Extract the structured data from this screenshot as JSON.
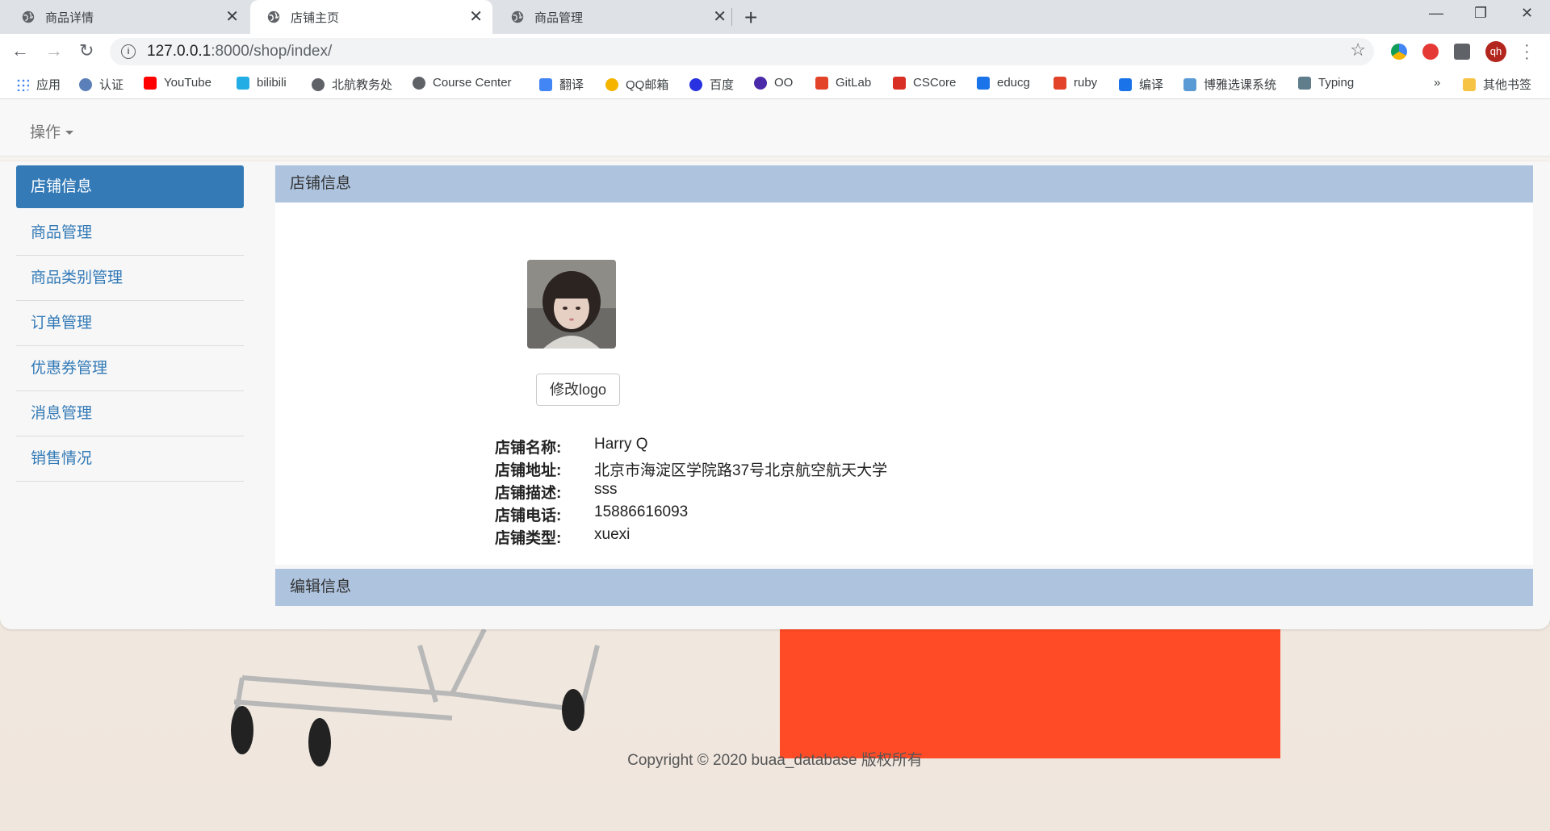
{
  "tabs": [
    {
      "title": "商品详情",
      "active": false
    },
    {
      "title": "店铺主页",
      "active": true
    },
    {
      "title": "商品管理",
      "active": false
    }
  ],
  "address": {
    "host": "127.0.0.1",
    "rest": ":8000/shop/index/"
  },
  "profile_initials": "qh",
  "bookmarks": [
    {
      "label": "应用",
      "color": "#4285f4"
    },
    {
      "label": "认证",
      "color": "#5b7fb8"
    },
    {
      "label": "YouTube",
      "color": "#ff0000"
    },
    {
      "label": "bilibili",
      "color": "#23ade5"
    },
    {
      "label": "北航教务处",
      "color": "#5f6368"
    },
    {
      "label": "Course Center",
      "color": "#5f6368"
    },
    {
      "label": "翻译",
      "color": "#4285f4"
    },
    {
      "label": "QQ邮箱",
      "color": "#f4b400"
    },
    {
      "label": "百度",
      "color": "#2932e1"
    },
    {
      "label": "OO",
      "color": "#4a2aa8"
    },
    {
      "label": "GitLab",
      "color": "#e24329"
    },
    {
      "label": "CSCore",
      "color": "#d93025"
    },
    {
      "label": "educg",
      "color": "#1a73e8"
    },
    {
      "label": "ruby",
      "color": "#e24329"
    },
    {
      "label": "编译",
      "color": "#1a73e8"
    },
    {
      "label": "博雅选课系统",
      "color": "#5b9bd5"
    },
    {
      "label": "Typing",
      "color": "#607d8b"
    }
  ],
  "bookmarks_overflow": "»",
  "other_bookmarks": "其他书签",
  "navbar": {
    "operations": "操作"
  },
  "sidebar": {
    "items": [
      {
        "label": "店铺信息",
        "active": true
      },
      {
        "label": "商品管理",
        "active": false
      },
      {
        "label": "商品类别管理",
        "active": false
      },
      {
        "label": "订单管理",
        "active": false
      },
      {
        "label": "优惠券管理",
        "active": false
      },
      {
        "label": "消息管理",
        "active": false
      },
      {
        "label": "销售情况",
        "active": false
      }
    ]
  },
  "shop_panel": {
    "title": "店铺信息",
    "logo_button": "修改logo",
    "fields": [
      {
        "key": "店铺名称:",
        "value": "Harry Q"
      },
      {
        "key": "店铺地址:",
        "value": "北京市海淀区学院路37号北京航空航天大学"
      },
      {
        "key": "店铺描述:",
        "value": "sss"
      },
      {
        "key": "店铺电话:",
        "value": "15886616093"
      },
      {
        "key": "店铺类型:",
        "value": "xuexi"
      }
    ]
  },
  "edit_panel": {
    "title": "编辑信息"
  },
  "footer": {
    "copyright": "Copyright © 2020  buaa_database 版权所有"
  }
}
